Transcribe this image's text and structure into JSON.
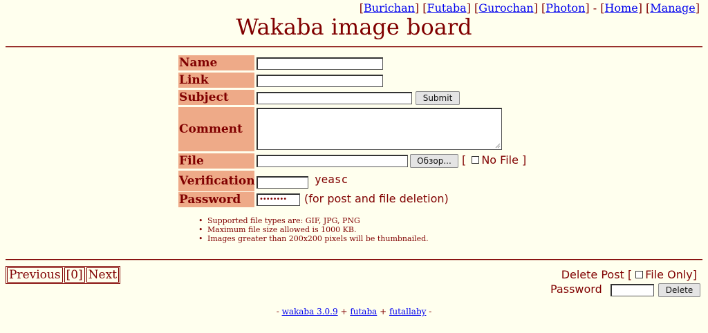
{
  "nav": {
    "links": [
      "Burichan",
      "Futaba",
      "Gurochan",
      "Photon"
    ],
    "sep_dash": " - ",
    "home": "Home",
    "manage": "Manage"
  },
  "title": "Wakaba image board",
  "form": {
    "name_label": "Name",
    "link_label": "Link",
    "subject_label": "Subject",
    "comment_label": "Comment",
    "file_label": "File",
    "verification_label": "Verification",
    "password_label": "Password",
    "submit_label": "Submit",
    "browse_label": "Обзор...",
    "no_file_label": "No File",
    "captcha_text": "yeasc",
    "password_value": "••••••••",
    "password_hint": "(for post and file deletion)"
  },
  "rules": [
    "Supported file types are: GIF, JPG, PNG",
    "Maximum file size allowed is 1000 KB.",
    "Images greater than 200x200 pixels will be thumbnailed."
  ],
  "pager": {
    "previous": "Previous",
    "page0": "[0]",
    "next": "Next"
  },
  "delete": {
    "delete_post_label": "Delete Post",
    "file_only_label": "File Only]",
    "password_label": "Password",
    "delete_button": "Delete"
  },
  "footer": {
    "prefix": "- ",
    "wakaba": "wakaba 3.0.9",
    "plus1": " + ",
    "futaba": "futaba",
    "plus2": " + ",
    "futallaby": "futallaby",
    "suffix": " -"
  },
  "colors": {
    "background": "#ffffee",
    "text": "#800000",
    "label_bg": "#eeaa88",
    "link": "#0000ee"
  }
}
